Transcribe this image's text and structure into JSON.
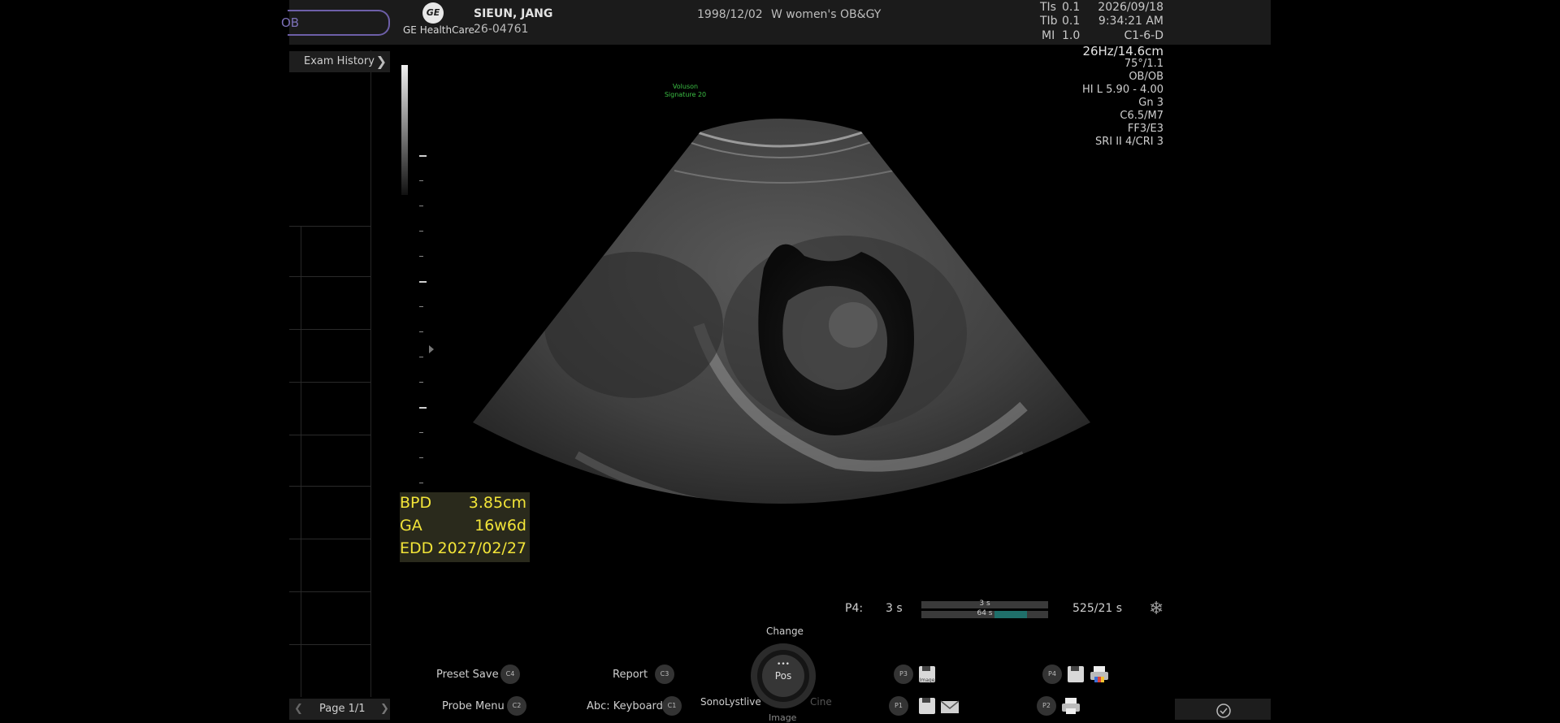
{
  "header": {
    "exam_type": "OB",
    "brand": "GE HealthCare",
    "logo_text": "GE",
    "patient_name": "SIEUN, JANG",
    "patient_id": "26-04761",
    "dob": "1998/12/02",
    "clinic": "W women's OB&GY",
    "tis_label": "TIs",
    "tis_value": "0.1",
    "tib_label": "TIb",
    "tib_value": "0.1",
    "mi_label": "MI",
    "mi_value": "1.0",
    "date": "2026/09/18",
    "time": "9:34:21 AM",
    "probe": "C1-6-D"
  },
  "left_panel": {
    "exam_history_label": "Exam History",
    "page_label": "Page 1/1"
  },
  "image": {
    "product_logo_line1": "Voluson",
    "product_logo_line2": "Signature 20",
    "frame_params": [
      "26Hz/14.6cm",
      "75°/1.1",
      "OB/OB",
      "HI L  5.90 - 4.00",
      "Gn  3",
      "C6.5/M7",
      "FF3/E3",
      "SRI II 4/CRI 3"
    ]
  },
  "measurements": [
    {
      "label": "BPD",
      "value": "3.85cm"
    },
    {
      "label": "GA",
      "value": "16w6d"
    },
    {
      "label": "EDD",
      "value": "2027/02/27"
    }
  ],
  "cine": {
    "preset_label": "P4:",
    "preset_value": "3 s",
    "bar_top_label": "3 s",
    "bar_bottom_label": "64 s",
    "bar_bottom_fill": 0.42,
    "counter": "525/21 s"
  },
  "controls": {
    "preset_save": "Preset Save",
    "preset_save_key": "C4",
    "report": "Report",
    "report_key": "C3",
    "probe_menu": "Probe Menu",
    "probe_menu_key": "C2",
    "keyboard": "Abc: Keyboard",
    "keyboard_key": "C1",
    "knob_top": "Change",
    "knob_center_dots": "•••",
    "knob_center": "Pos",
    "knob_left": "SonoLystlive",
    "knob_right": "Cine",
    "knob_bottom": "Image",
    "p3_key": "P3",
    "p4_key": "P4",
    "p1_key": "P1",
    "p2_key": "P2",
    "save_icon_text": "Image"
  },
  "colors": {
    "measurement_text": "#f2e438",
    "logo_green": "#3bbf44",
    "pill_purple": "#6d5fa8",
    "cine_fill": "#1f6f6a"
  }
}
